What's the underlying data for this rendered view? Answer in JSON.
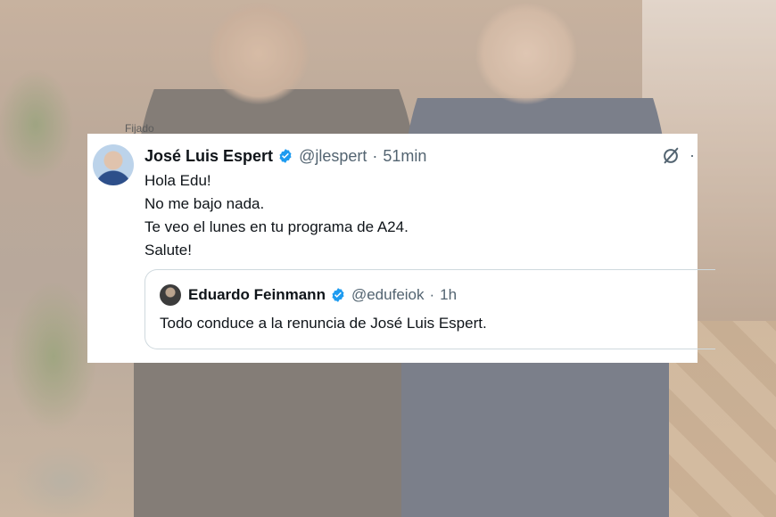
{
  "pinned_label": "Fijado",
  "tweet": {
    "author_name": "José Luis Espert",
    "handle": "@jlespert",
    "separator": "·",
    "time": "51min",
    "lines": [
      "Hola Edu!",
      "No me bajo nada.",
      "Te veo el lunes en tu programa de A24.",
      "Salute!"
    ],
    "more_glyph": "·"
  },
  "quoted_tweet": {
    "author_name": "Eduardo Feinmann",
    "handle": "@edufeiok",
    "separator": "·",
    "time": "1h",
    "text": "Todo conduce a la renuncia de José Luis Espert."
  },
  "colors": {
    "verified": "#1d9bf0",
    "text": "#0f1419",
    "muted": "#536471"
  },
  "icons": {
    "verified": "verified-badge-icon",
    "grok": "grok-icon"
  }
}
